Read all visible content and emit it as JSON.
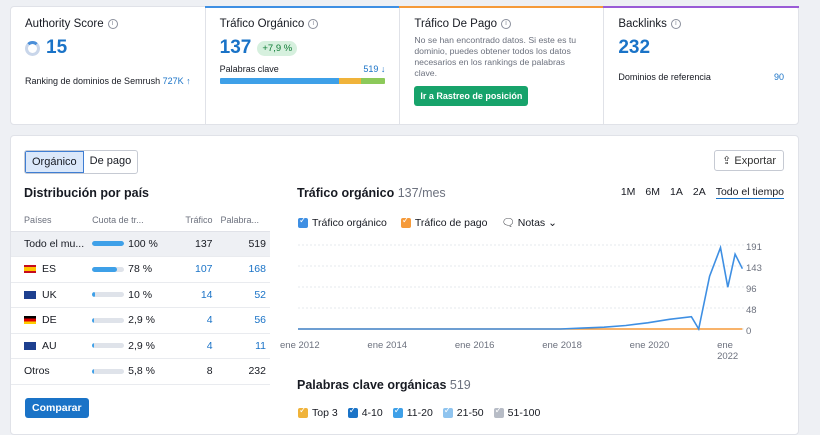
{
  "cards": {
    "authority": {
      "title": "Authority Score",
      "value": "15",
      "sub_label": "Ranking de dominios de Semrush",
      "sub_value": "727K ↑"
    },
    "organic": {
      "title": "Tráfico Orgánico",
      "value": "137",
      "badge": "+7,9 %",
      "sub_label": "Palabras clave",
      "sub_value": "519 ↓"
    },
    "paid": {
      "title": "Tráfico De Pago",
      "note": "No se han encontrado datos. Si este es tu dominio, puedes obtener todos los datos necesarios en los rankings de palabras clave.",
      "button": "Ir a Rastreo de posición"
    },
    "backlinks": {
      "title": "Backlinks",
      "value": "232",
      "sub_label": "Dominios de referencia",
      "sub_value": "90"
    }
  },
  "segment": {
    "organic": "Orgánico",
    "paid": "De pago"
  },
  "export_label": "Exportar",
  "country": {
    "title": "Distribución por país",
    "headers": [
      "Países",
      "Cuota de tr...",
      "Tráfico",
      "Palabra..."
    ],
    "rows": [
      {
        "name": "Todo el mu...",
        "share": "100 %",
        "share_value": 1.0,
        "traffic": "137",
        "keywords": "519"
      },
      {
        "name": "ES",
        "share": "78 %",
        "share_value": 0.78,
        "traffic": "107",
        "keywords": "168"
      },
      {
        "name": "UK",
        "share": "10 %",
        "share_value": 0.1,
        "traffic": "14",
        "keywords": "52"
      },
      {
        "name": "DE",
        "share": "2,9 %",
        "share_value": 0.029,
        "traffic": "4",
        "keywords": "56"
      },
      {
        "name": "AU",
        "share": "2,9 %",
        "share_value": 0.029,
        "traffic": "4",
        "keywords": "11"
      },
      {
        "name": "Otros",
        "share": "5,8 %",
        "share_value": 0.058,
        "traffic": "8",
        "keywords": "232"
      }
    ],
    "compare_button": "Comparar"
  },
  "traffic_chart": {
    "title": "Tráfico orgánico",
    "title_suffix": "137/mes",
    "ranges": [
      "1M",
      "6M",
      "1A",
      "2A",
      "Todo el tiempo"
    ],
    "legend": {
      "organic": "Tráfico orgánico",
      "paid": "Tráfico de pago",
      "notes": "Notas"
    },
    "x_labels": [
      "ene 2012",
      "ene 2014",
      "ene 2016",
      "ene 2018",
      "ene 2020",
      "ene 2022"
    ],
    "y_labels": [
      "191",
      "143",
      "96",
      "48",
      "0"
    ]
  },
  "keywords": {
    "title": "Palabras clave orgánicas",
    "count": "519",
    "legend": [
      "Top 3",
      "4-10",
      "11-20",
      "21-50",
      "51-100"
    ]
  },
  "colors": {
    "accent": "#1a73c7",
    "green": "#17a36b",
    "orange": "#f59a3a",
    "purple": "#9a5bd6"
  },
  "chart_data": {
    "type": "line",
    "x": [
      "2012-01",
      "2013-01",
      "2014-01",
      "2015-01",
      "2016-01",
      "2017-01",
      "2018-01",
      "2018-07",
      "2019-01",
      "2019-07",
      "2020-01",
      "2020-07",
      "2021-01",
      "2021-03",
      "2021-06",
      "2021-09",
      "2021-11",
      "2022-01",
      "2022-03"
    ],
    "series": [
      {
        "name": "Tráfico orgánico",
        "values": [
          0,
          0,
          0,
          0,
          0,
          0,
          0,
          2,
          4,
          8,
          14,
          22,
          28,
          0,
          120,
          185,
          95,
          170,
          137
        ]
      },
      {
        "name": "Tráfico de pago",
        "values": [
          0,
          0,
          0,
          0,
          0,
          0,
          0,
          0,
          0,
          0,
          0,
          0,
          0,
          0,
          0,
          0,
          0,
          0,
          0
        ]
      }
    ],
    "ylim": [
      0,
      191
    ],
    "grid": true
  }
}
